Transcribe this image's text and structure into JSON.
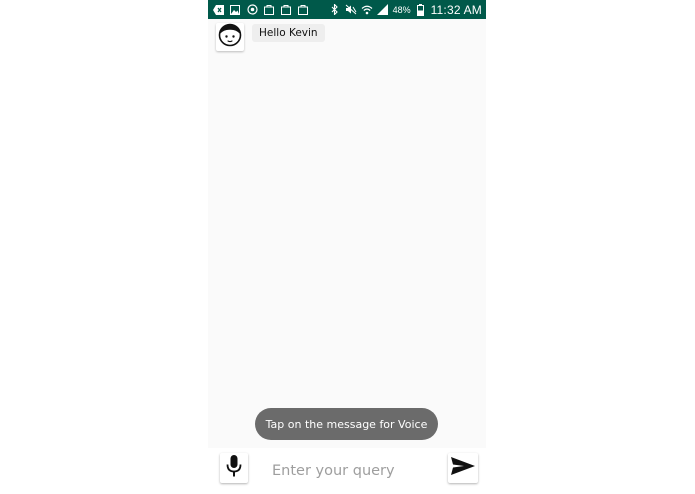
{
  "status_bar": {
    "battery": "48%",
    "time": "11:32 AM",
    "icons_left": [
      "back-icon",
      "gallery-icon",
      "sync-icon",
      "shopping-bag-icon",
      "shopping-bag-icon",
      "shopping-bag-icon"
    ],
    "icons_right": [
      "bluetooth-icon",
      "mute-icon",
      "wifi-icon",
      "signal-icon",
      "battery-icon"
    ],
    "color": "#00594a"
  },
  "chat": {
    "messages": [
      {
        "sender": "bot",
        "text": "Hello Kevin",
        "avatar_icon": "face-avatar-icon"
      }
    ]
  },
  "toast": {
    "text": "Tap on the message for Voice"
  },
  "input_bar": {
    "mic_icon": "microphone-icon",
    "placeholder": "Enter your query",
    "value": "",
    "send_icon": "send-icon"
  }
}
